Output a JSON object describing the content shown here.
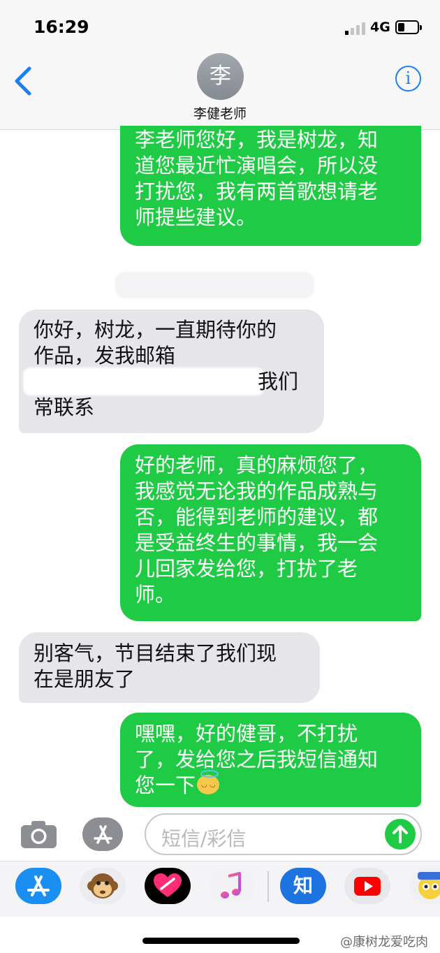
{
  "status_bar": {
    "time": "16:29",
    "network": "4G"
  },
  "header": {
    "avatar_initial": "李",
    "contact_name": "李健老师"
  },
  "messages": [
    {
      "side": "sent",
      "lines": [
        "李老师您好，我是树龙，知",
        "道您最近忙演唱会，所以没",
        "打扰您，我有两首歌想请老",
        "师提些建议。"
      ]
    },
    {
      "side": "received",
      "lines": [
        "你好，树龙，一直期待你的",
        "作品，发我邮箱",
        "我们",
        "常联系"
      ]
    },
    {
      "side": "sent",
      "lines": [
        "好的老师，真的麻烦您了，",
        "我感觉无论我的作品成熟与",
        "否，能得到老师的建议，都",
        "是受益终生的事情，我一会",
        "儿回家发给您，打扰了老",
        "师。"
      ]
    },
    {
      "side": "received",
      "lines": [
        "别客气，节目结束了我们现",
        "在是朋友了"
      ]
    },
    {
      "side": "sent",
      "lines": [
        "嘿嘿，好的健哥，不打扰",
        "了，发给您之后我短信通知",
        "您一下"
      ]
    }
  ],
  "input": {
    "placeholder": "短信/彩信"
  },
  "apps": {
    "zhihu_label": "知"
  },
  "watermark": "@康树龙爱吃肉",
  "colors": {
    "sent": "#1fcb45",
    "received": "#e5e5ea",
    "accent": "#1a7ff5"
  }
}
